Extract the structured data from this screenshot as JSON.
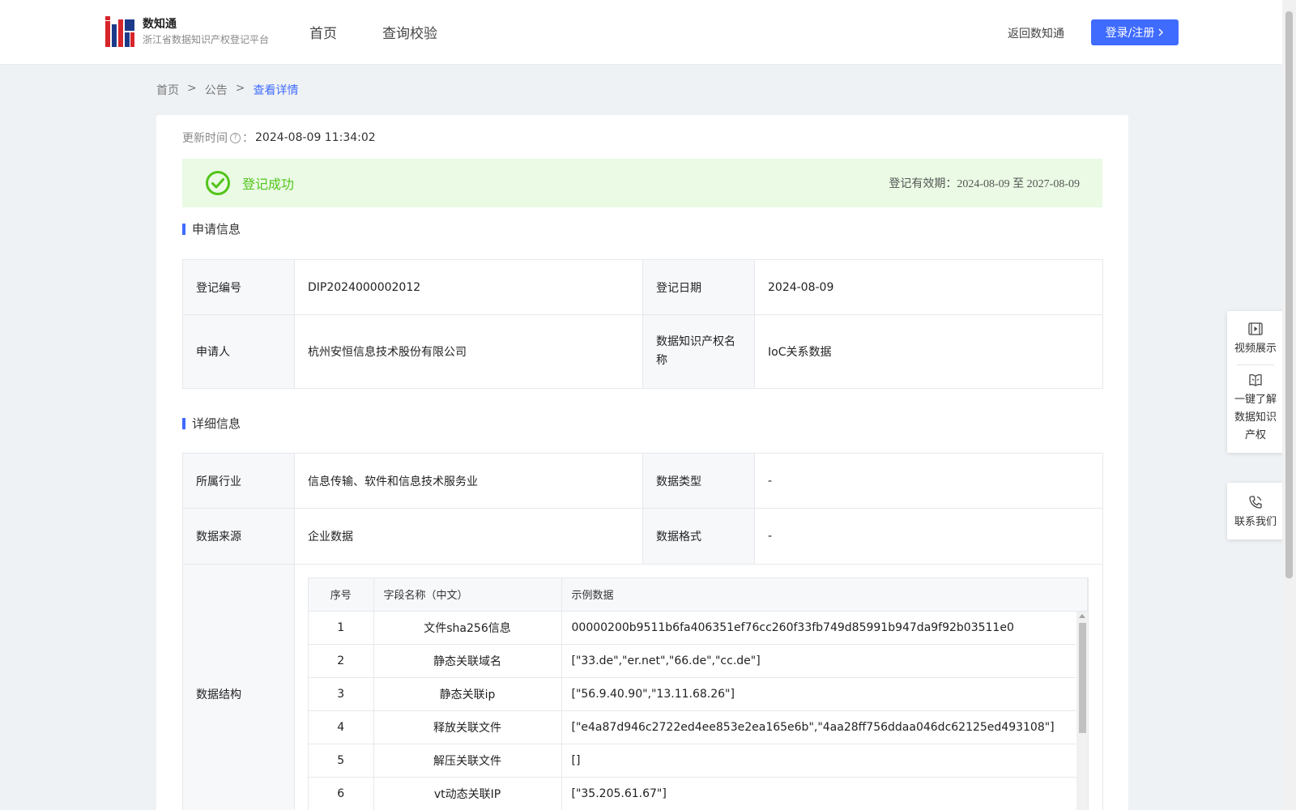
{
  "header": {
    "brand_name": "数知通",
    "brand_sub": "浙江省数据知识产权登记平台",
    "nav": [
      "首页",
      "查询校验"
    ],
    "return_link": "返回数知通",
    "login_label": "登录/注册"
  },
  "breadcrumb": {
    "home": "首页",
    "sep": ">",
    "notice": "公告",
    "current": "查看详情"
  },
  "update": {
    "label": "更新时间",
    "suffix": "：",
    "value": "2024-08-09 11:34:02"
  },
  "status": {
    "text": "登记成功",
    "validity_label": "登记有效期：",
    "validity_value": "2024-08-09 至 2027-08-09",
    "color": "#52c41a"
  },
  "application": {
    "title": "申请信息",
    "reg_no_label": "登记编号",
    "reg_no": "DIP2024000002012",
    "reg_date_label": "登记日期",
    "reg_date": "2024-08-09",
    "applicant_label": "申请人",
    "applicant": "杭州安恒信息技术股份有限公司",
    "ip_name_label": "数据知识产权名称",
    "ip_name": "IoC关系数据"
  },
  "detail": {
    "title": "详细信息",
    "industry_label": "所属行业",
    "industry": "信息传输、软件和信息技术服务业",
    "data_type_label": "数据类型",
    "data_type": "-",
    "source_label": "数据来源",
    "source": "企业数据",
    "format_label": "数据格式",
    "format": "-",
    "structure_label": "数据结构",
    "structure_headers": [
      "序号",
      "字段名称（中文）",
      "示例数据"
    ],
    "structure_rows": [
      [
        "1",
        "文件sha256信息",
        "00000200b9511b6fa406351ef76cc260f33fb749d85991b947da9f92b03511e0"
      ],
      [
        "2",
        "静态关联域名",
        "[\"33.de\",\"er.net\",\"66.de\",\"cc.de\"]"
      ],
      [
        "3",
        "静态关联ip",
        "[\"56.9.40.90\",\"13.11.68.26\"]"
      ],
      [
        "4",
        "释放关联文件",
        "[\"e4a87d946c2722ed4ee853e2ea165e6b\",\"4aa28ff756ddaa046dc62125ed493108\"]"
      ],
      [
        "5",
        "解压关联文件",
        "[]"
      ],
      [
        "6",
        "vt动态关联IP",
        "[\"35.205.61.67\"]"
      ]
    ]
  },
  "side": {
    "video": "视频展示",
    "learn": [
      "一键了解",
      "数据知识",
      "产权"
    ],
    "contact": "联系我们"
  },
  "colors": {
    "accent": "#3f6bff",
    "success_bg": "#eafae4"
  }
}
